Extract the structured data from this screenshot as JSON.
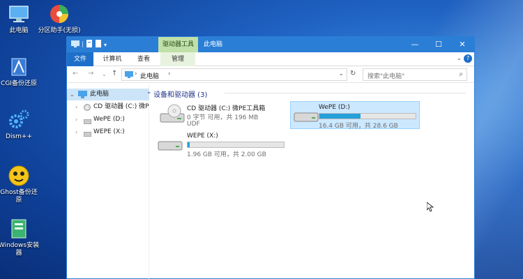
{
  "desktop": {
    "icons": [
      {
        "label": "此电脑"
      },
      {
        "label": "分区助手(无损)"
      },
      {
        "label": "CGI备份还原"
      },
      {
        "label": "Dism++"
      },
      {
        "label": "Ghost备份还原"
      },
      {
        "label": "Windows安装器"
      }
    ]
  },
  "window": {
    "context_tab": "驱动器工具",
    "title": "此电脑",
    "controls": {
      "minimize": "—",
      "maximize": "☐",
      "close": "✕"
    },
    "ribbon_tabs": [
      "文件",
      "计算机",
      "查看",
      "管理"
    ],
    "address": "此电脑",
    "search_placeholder": "搜索\"此电脑\""
  },
  "nav_pane": {
    "items": [
      {
        "label": "此电脑",
        "selected": true
      },
      {
        "label": "CD 驱动器 (C:) 微P"
      },
      {
        "label": "WePE (D:)"
      },
      {
        "label": "WEPE (X:)"
      }
    ]
  },
  "content": {
    "group_header": "设备和驱动器 (3)",
    "drives": [
      {
        "name": "CD 驱动器 (C:) 微PE工具箱",
        "line2": "0 字节 可用，共 196 MB",
        "line3": "UDF",
        "type": "cd"
      },
      {
        "name": "WePE (D:)",
        "usage": 0.43,
        "line2": "16.4 GB 可用，共 28.6 GB",
        "selected": true,
        "type": "hdd"
      },
      {
        "name": "WEPE (X:)",
        "usage": 0.02,
        "line2": "1.96 GB 可用，共 2.00 GB",
        "type": "hdd"
      }
    ]
  },
  "colors": {
    "accent": "#2b7ed6",
    "bar_fill": "#26a0da",
    "selection": "#cce8ff"
  }
}
